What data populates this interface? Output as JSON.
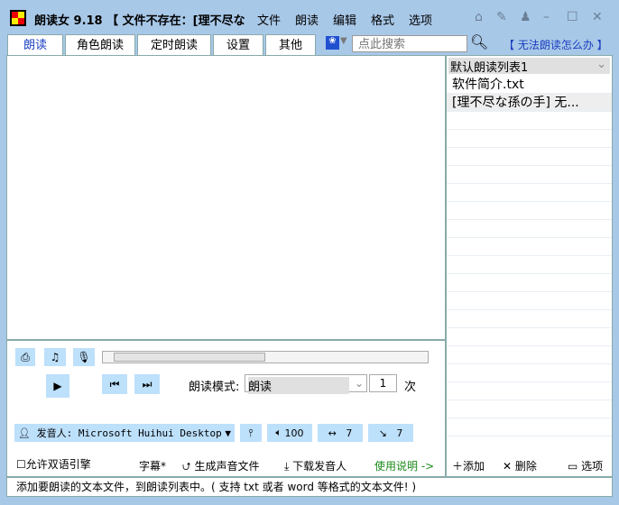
{
  "app": {
    "title": "朗读女 9.18 【 文件不存在：[理不尽な"
  },
  "menu": [
    "文件",
    "朗读",
    "编辑",
    "格式",
    "选项"
  ],
  "tabs": [
    "朗读",
    "角色朗读",
    "定时朗读",
    "设置",
    "其他"
  ],
  "search": {
    "placeholder": "点此搜索"
  },
  "help_link": "【 无法朗读怎么办 】",
  "controls": {
    "mode_label": "朗读模式:",
    "mode_value": "朗读",
    "repeat": "1",
    "repeat_unit": "次",
    "voice": "发音人: Microsoft Huihui Desktop",
    "volume": "100",
    "speed": "7",
    "pitch": "7",
    "bilingual": "允许双语引擎",
    "subtitle": "字幕*",
    "generate": "生成声音文件",
    "download": "下载发音人",
    "manual": "使用说明 ->"
  },
  "playlist": {
    "selected": "默认朗读列表1",
    "items": [
      "软件简介.txt",
      "[理不尽な孫の手] 无..."
    ],
    "add": "添加",
    "delete": "删除",
    "options": "选项"
  },
  "status": "添加要朗读的文本文件，到朗读列表中。( 支持 txt 或者 word 等格式的文本文件! )"
}
